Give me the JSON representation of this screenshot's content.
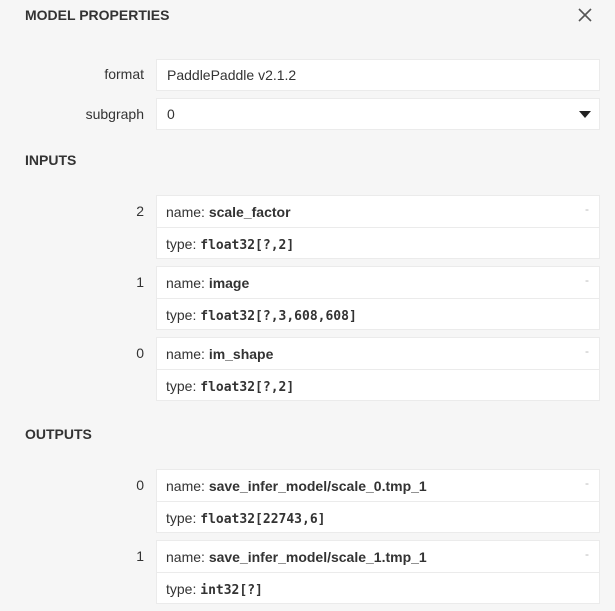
{
  "panel": {
    "title": "MODEL PROPERTIES",
    "close_icon": "close-icon"
  },
  "properties": {
    "format_label": "format",
    "format_value": "PaddlePaddle v2.1.2",
    "subgraph_label": "subgraph",
    "subgraph_value": "0"
  },
  "inputs": {
    "title": "INPUTS",
    "items": [
      {
        "index": "2",
        "name_key": "name: ",
        "name": "scale_factor",
        "type_key": "type: ",
        "type": "float32[?,2]",
        "dash": "-"
      },
      {
        "index": "1",
        "name_key": "name: ",
        "name": "image",
        "type_key": "type: ",
        "type": "float32[?,3,608,608]",
        "dash": "-"
      },
      {
        "index": "0",
        "name_key": "name: ",
        "name": "im_shape",
        "type_key": "type: ",
        "type": "float32[?,2]",
        "dash": "-"
      }
    ]
  },
  "outputs": {
    "title": "OUTPUTS",
    "items": [
      {
        "index": "0",
        "name_key": "name: ",
        "name": "save_infer_model/scale_0.tmp_1",
        "type_key": "type: ",
        "type": "float32[22743,6]",
        "dash": "-"
      },
      {
        "index": "1",
        "name_key": "name: ",
        "name": "save_infer_model/scale_1.tmp_1",
        "type_key": "type: ",
        "type": "int32[?]",
        "dash": "-"
      }
    ]
  }
}
